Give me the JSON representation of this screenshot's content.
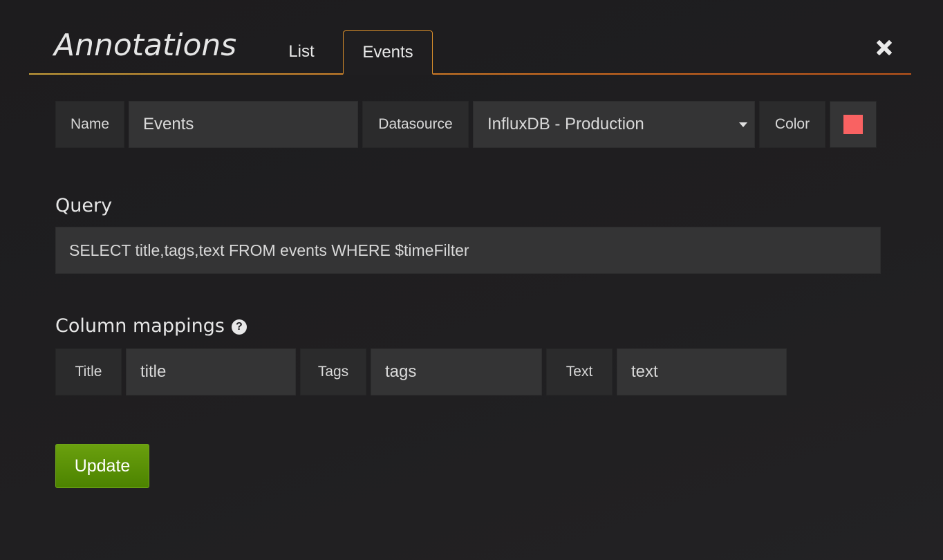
{
  "modal": {
    "title": "Annotations",
    "tabs": [
      {
        "label": "List",
        "active": false
      },
      {
        "label": "Events",
        "active": true
      }
    ]
  },
  "form": {
    "name_label": "Name",
    "name_value": "Events",
    "datasource_label": "Datasource",
    "datasource_value": "InfluxDB - Production",
    "color_label": "Color",
    "color_value": "#f96262"
  },
  "query": {
    "heading": "Query",
    "value": "SELECT title,tags,text FROM events WHERE $timeFilter"
  },
  "mappings": {
    "heading": "Column mappings",
    "title_label": "Title",
    "title_value": "title",
    "tags_label": "Tags",
    "tags_value": "tags",
    "text_label": "Text",
    "text_value": "text"
  },
  "actions": {
    "update_label": "Update"
  },
  "colors": {
    "accent_tab_border": "#d38b2b",
    "update_button": "#5a9208"
  },
  "icons": {
    "close": "close-icon",
    "help": "question-circle-icon",
    "caret": "caret-down-icon"
  }
}
